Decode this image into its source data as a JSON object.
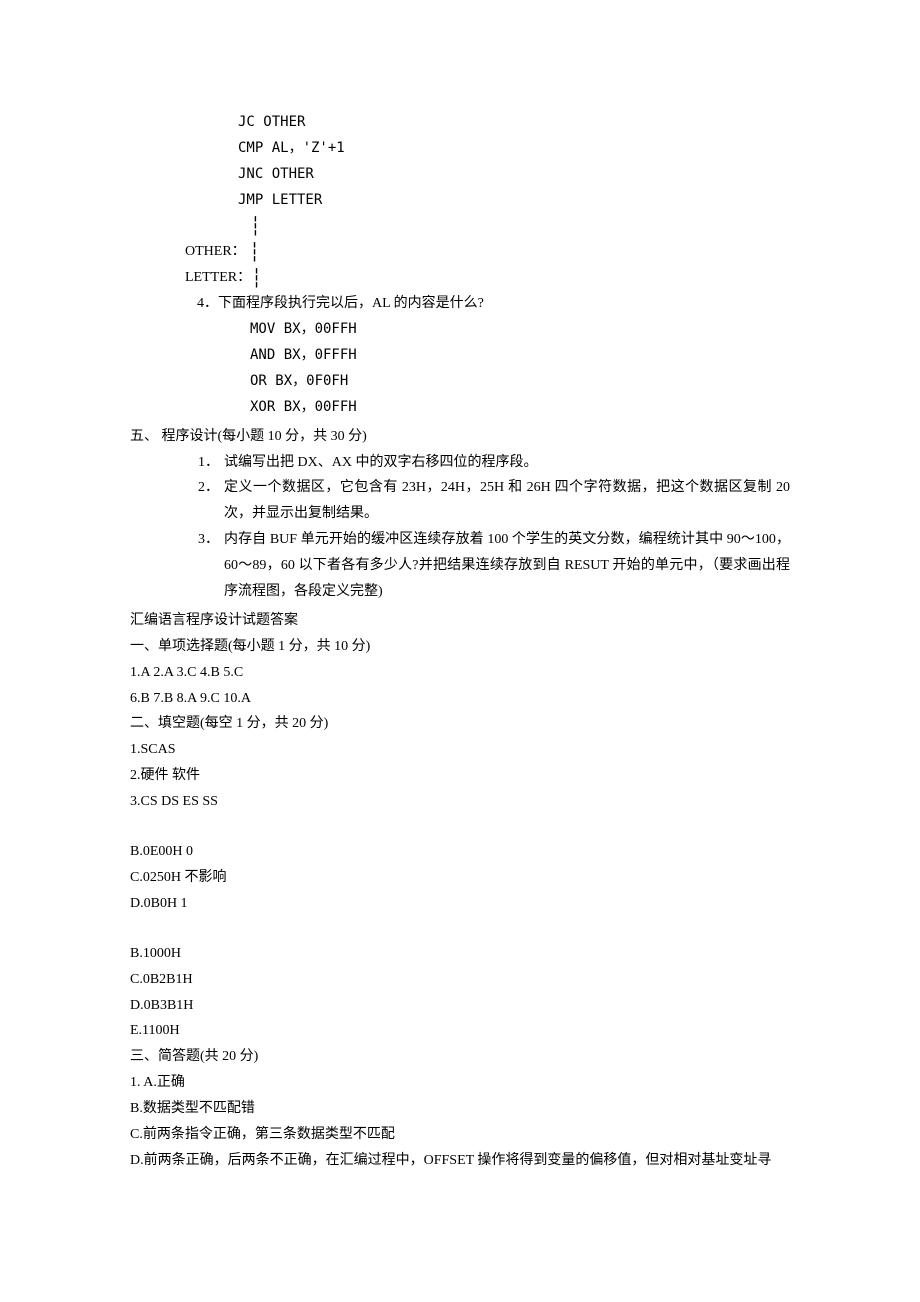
{
  "codeblock1": {
    "l1": "JC OTHER",
    "l2": "CMP AL，'Z'+1",
    "l3": "JNC OTHER",
    "l4": "JMP LETTER",
    "other": "OTHER：",
    "letter": "LETTER："
  },
  "q4": {
    "title": "4．下面程序段执行完以后，AL 的内容是什么?",
    "l1": "MOV BX，00FFH",
    "l2": "AND BX，0FFFH",
    "l3": "OR BX，0F0FH",
    "l4": "XOR BX，00FFH"
  },
  "section5": {
    "title": "五、 程序设计(每小题 10 分，共 30 分)",
    "items": [
      {
        "num": "1．",
        "text": "试编写出把 DX、AX 中的双字右移四位的程序段。"
      },
      {
        "num": "2．",
        "text": "定义一个数据区，它包含有 23H，24H，25H 和 26H 四个字符数据，把这个数据区复制 20 次，并显示出复制结果。"
      },
      {
        "num": "3．",
        "text": "内存自 BUF 单元开始的缓冲区连续存放着 100 个学生的英文分数，编程统计其中 90～100，60～89，60 以下者各有多少人?并把结果连续存放到自 RESUT 开始的单元中，（要求画出程序流程图，各段定义完整)"
      }
    ]
  },
  "answers": {
    "title": "汇编语言程序设计试题答案",
    "sec1": "一、单项选择题(每小题 1 分，共 10 分)",
    "sec1a": "1.A 2.A 3.C 4.B 5.C",
    "sec1b": "6.B 7.B 8.A 9.C 10.A",
    "sec2": "二、填空题(每空 1 分，共 20 分)",
    "sec2a": "1.SCAS",
    "sec2b": "2.硬件  软件",
    "sec2c": "3.CS DS ES SS",
    "blockB": [
      "B.0E00H 0",
      "C.0250H  不影响",
      "D.0B0H 1"
    ],
    "blockC": [
      "B.1000H",
      "C.0B2B1H",
      "D.0B3B1H",
      "E.1100H"
    ],
    "sec3": "三、简答题(共 20 分)",
    "sec3_items": [
      "1. A.正确",
      "B.数据类型不匹配错",
      "C.前两条指令正确，第三条数据类型不匹配",
      "D.前两条正确，后两条不正确，在汇编过程中，OFFSET 操作将得到变量的偏移值，但对相对基址变址寻"
    ]
  }
}
